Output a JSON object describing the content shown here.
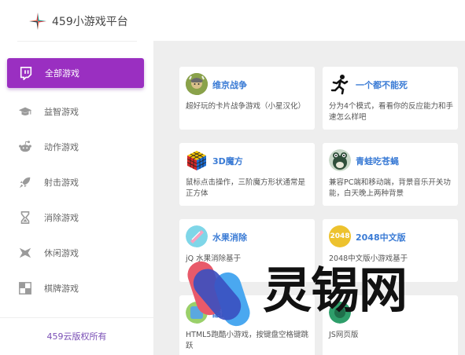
{
  "brand": {
    "name": "459小游戏平台",
    "logo_icon": "star-logo-icon"
  },
  "nav": {
    "items": [
      {
        "label": "全部游戏",
        "icon": "twitch-icon",
        "active": true
      },
      {
        "label": "益智游戏",
        "icon": "graduation-cap-icon",
        "active": false
      },
      {
        "label": "动作游戏",
        "icon": "reddit-alien-icon",
        "active": false
      },
      {
        "label": "射击游戏",
        "icon": "rocket-icon",
        "active": false
      },
      {
        "label": "消除游戏",
        "icon": "hourglass-icon",
        "active": false
      },
      {
        "label": "休闲游戏",
        "icon": "starburst-icon",
        "active": false
      },
      {
        "label": "棋牌游戏",
        "icon": "board-square-icon",
        "active": false
      }
    ]
  },
  "footer": {
    "text": "459云版权所有"
  },
  "games": [
    {
      "title": "维京战争",
      "desc": "超好玩的卡片战争游戏（小星汉化）",
      "thumb": "viking-thumb-icon"
    },
    {
      "title": "一个都不能死",
      "desc": "分为4个模式，看看你的反应能力和手速怎么样吧",
      "thumb": "running-man-icon"
    },
    {
      "title": "3D魔方",
      "desc": "鼠标点击操作，三阶魔方形状通常是正方体",
      "thumb": "rubiks-cube-icon"
    },
    {
      "title": "青蛙吃苍蝇",
      "desc": "兼容PC端和移动端，背景音乐开关功能，白天晚上两种背景",
      "thumb": "frog-icon"
    },
    {
      "title": "水果消除",
      "desc": "jQ 水果消除基于",
      "thumb": "fruit-icon"
    },
    {
      "title": "2048中文版",
      "desc": "2048中文版小游戏基于",
      "thumb": "2048-tile-icon",
      "thumb_text": "2048"
    },
    {
      "title": "酷跑",
      "desc": "HTML5跑酷小游戏，按键盘空格键跳跃",
      "thumb": "runner-thumb-icon"
    },
    {
      "title": "",
      "desc": "JS网页版",
      "thumb": "green-circle-icon"
    }
  ],
  "colors": {
    "accent": "#9a2fc1",
    "title_blue": "#3a7bd5",
    "main_bg": "#eeeeee"
  },
  "watermark": {
    "text": "灵锡网"
  }
}
